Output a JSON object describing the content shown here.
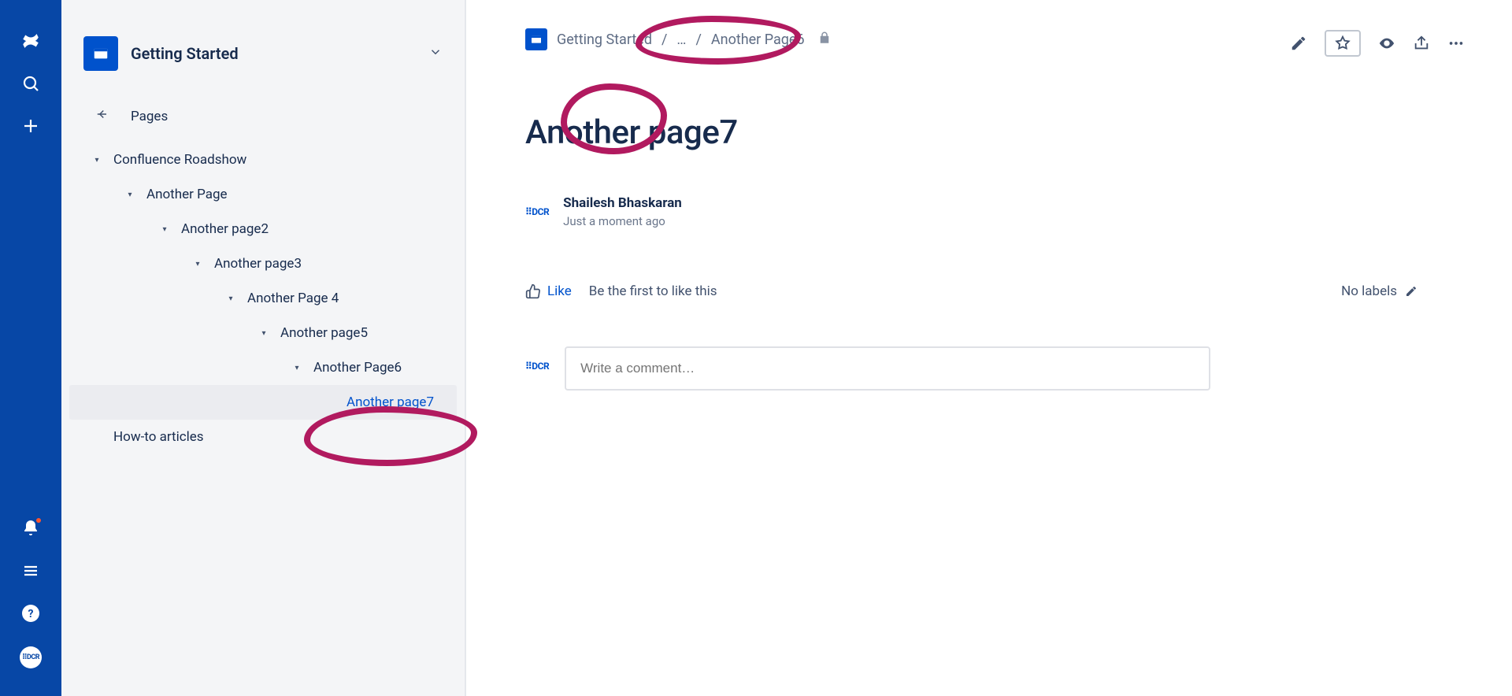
{
  "space": {
    "title": "Getting Started",
    "nav_label": "Pages"
  },
  "tree": [
    {
      "label": "Confluence Roadshow",
      "level": 0,
      "expandable": true,
      "selected": false
    },
    {
      "label": "Another Page",
      "level": 1,
      "expandable": true,
      "selected": false
    },
    {
      "label": "Another page2",
      "level": 2,
      "expandable": true,
      "selected": false
    },
    {
      "label": "Another page3",
      "level": 3,
      "expandable": true,
      "selected": false
    },
    {
      "label": "Another Page 4",
      "level": 4,
      "expandable": true,
      "selected": false
    },
    {
      "label": "Another page5",
      "level": 5,
      "expandable": true,
      "selected": false
    },
    {
      "label": "Another Page6",
      "level": 6,
      "expandable": true,
      "selected": false
    },
    {
      "label": "Another page7",
      "level": 7,
      "expandable": false,
      "selected": true
    },
    {
      "label": "How-to articles",
      "level": 0,
      "expandable": false,
      "selected": false
    }
  ],
  "breadcrumb": {
    "root": "Getting Started",
    "ellipsis": "…",
    "last": "Another Page6"
  },
  "page": {
    "title": "Another page7",
    "author": "Shailesh Bhaskaran",
    "timestamp": "Just a moment ago",
    "like_label": "Like",
    "like_cta": "Be the first to like this",
    "labels_text": "No labels",
    "comment_placeholder": "Write a comment…",
    "dcr_label": "⠿DCR"
  }
}
